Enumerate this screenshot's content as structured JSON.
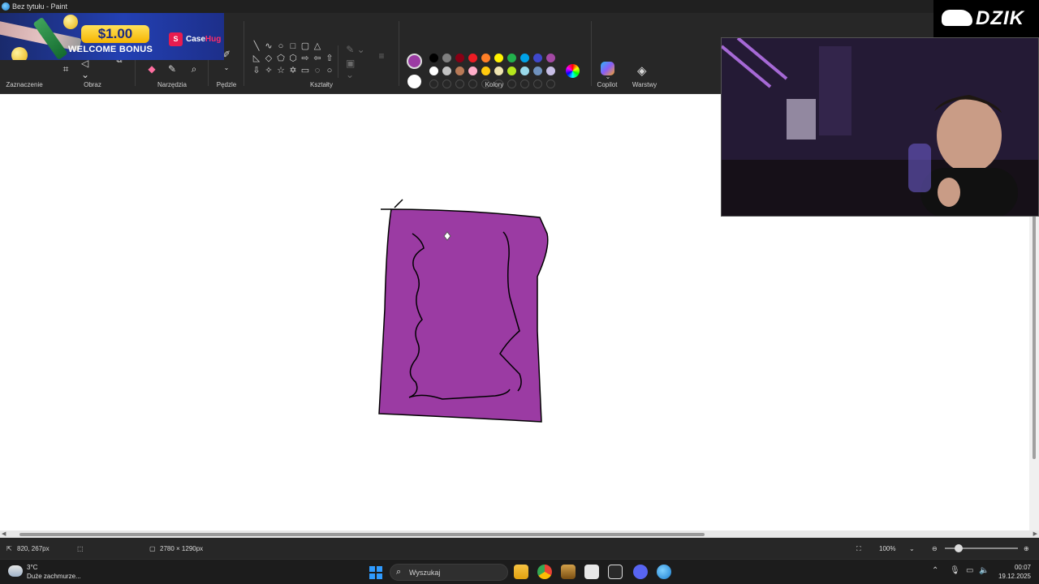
{
  "window": {
    "title": "Bez tytułu - Paint"
  },
  "promo": {
    "amount": "$1.00",
    "bonus_text": "WELCOME BONUS",
    "logo_mark": "S",
    "logo_case": "Case",
    "logo_hug": "Hug"
  },
  "ribbon": {
    "groups": {
      "selection": "Zaznaczenie",
      "image": "Obraz",
      "tools": "Narzędzia",
      "brushes": "Pędzle",
      "shapes": "Kształty",
      "colors": "Kolory",
      "copilot": "Copilot",
      "layers": "Warstwy"
    },
    "current_color": "#9b3ba3",
    "secondary_color": "#ffffff",
    "palette_row1": [
      "#000000",
      "#7f7f7f",
      "#880015",
      "#ed1c24",
      "#ff7f27",
      "#fff200",
      "#22b14c",
      "#00a2e8",
      "#3f48cc",
      "#a349a4"
    ],
    "palette_row2": [
      "#ffffff",
      "#c3c3c3",
      "#b97a57",
      "#ffaec9",
      "#ffc90e",
      "#efe4b0",
      "#b5e61d",
      "#99d9ea",
      "#7092be",
      "#c8bfe7"
    ]
  },
  "drawing": {
    "fill_color": "#9b3ba3",
    "stroke_color": "#000000"
  },
  "statusbar": {
    "cursor_position": "820, 267px",
    "canvas_size": "2780 × 1290px",
    "zoom": "100%"
  },
  "streamer": {
    "logo_text": "DZIK"
  },
  "taskbar": {
    "weather_temp": "3°C",
    "weather_desc": "Duże zachmurze...",
    "search_placeholder": "Wyszukaj",
    "time": "00:07",
    "date": "19.12.2025"
  }
}
